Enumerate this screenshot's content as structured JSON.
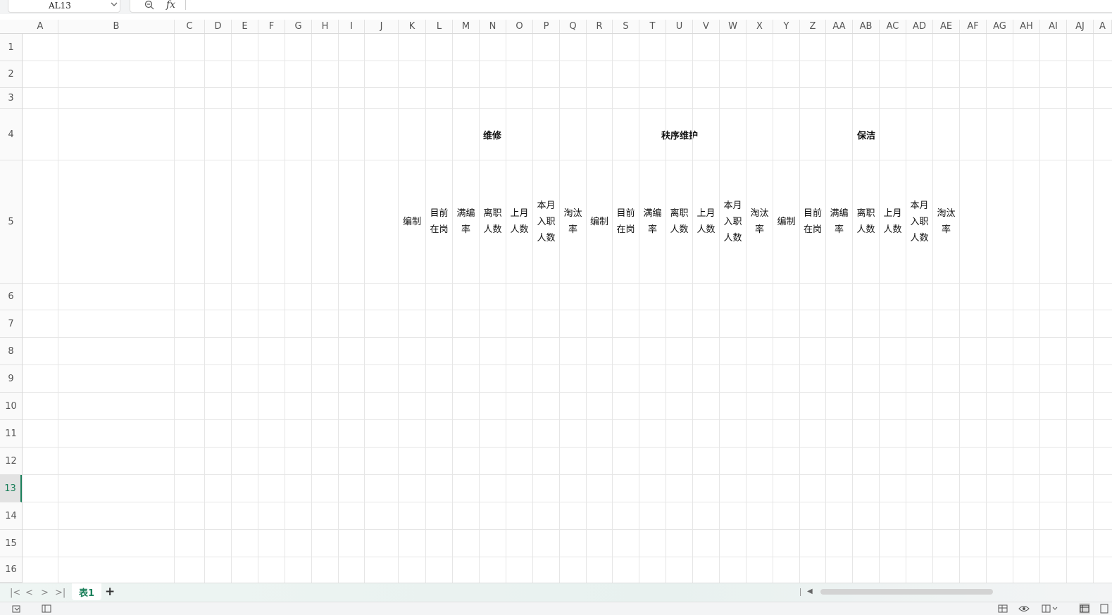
{
  "formula_bar": {
    "name_box_value": "AL13",
    "fx_label": "fx",
    "formula_value": ""
  },
  "columns": [
    "A",
    "B",
    "C",
    "D",
    "E",
    "F",
    "G",
    "H",
    "I",
    "J",
    "K",
    "L",
    "M",
    "N",
    "O",
    "P",
    "Q",
    "R",
    "S",
    "T",
    "U",
    "V",
    "W",
    "X",
    "Y",
    "Z",
    "AA",
    "AB",
    "AC",
    "AD",
    "AE",
    "AF",
    "AG",
    "AH",
    "AI",
    "AJ",
    "A"
  ],
  "rows": [
    "1",
    "2",
    "3",
    "4",
    "5",
    "6",
    "7",
    "8",
    "9",
    "10",
    "11",
    "12",
    "13",
    "14",
    "15",
    "16"
  ],
  "active_row": "13",
  "table": {
    "groups": [
      {
        "title": "维修",
        "headers": [
          "编制",
          "目前\n在岗",
          "满编\n率",
          "离职\n人数",
          "上月\n人数",
          "本月\n入职\n人数",
          "淘汰\n率"
        ]
      },
      {
        "title": "秩序维护",
        "headers": [
          "编制",
          "目前\n在岗",
          "满编\n率",
          "离职\n人数",
          "上月\n人数",
          "本月\n入职\n人数",
          "淘汰\n率"
        ]
      },
      {
        "title": "保洁",
        "headers": [
          "编制",
          "目前\n在岗",
          "满编\n率",
          "离职\n人数",
          "上月\n人数",
          "本月\n入职\n人数",
          "淘汰\n率"
        ]
      }
    ]
  },
  "sheet_tabs": {
    "active_tab": "表1",
    "add_label": "+"
  },
  "icons": {
    "name_box_dropdown": "chevron-down-icon",
    "zoom": "zoom-out-icon",
    "first_sheet": "first-sheet-icon",
    "prev_sheet": "prev-sheet-icon",
    "next_sheet": "next-sheet-icon",
    "last_sheet": "last-sheet-icon"
  },
  "colors": {
    "accent": "#1a7f5a",
    "grid_line": "#e6e6e6",
    "table_border": "#111111"
  }
}
